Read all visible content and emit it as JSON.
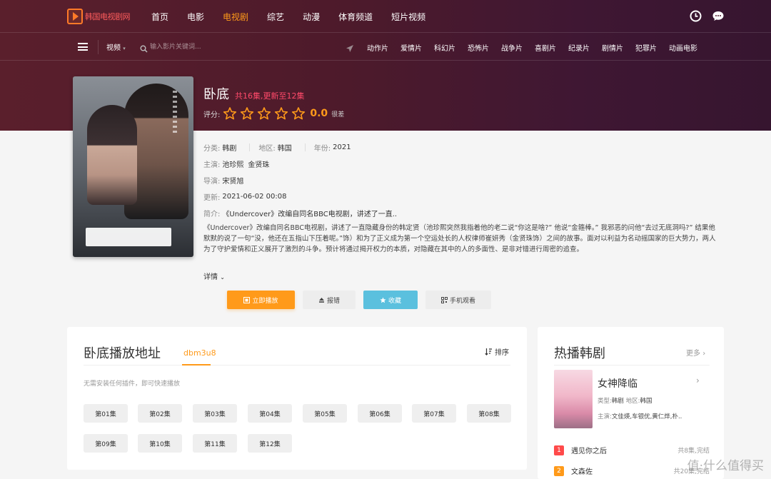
{
  "site": {
    "name": "韩国电视剧网"
  },
  "nav": {
    "items": [
      "首页",
      "电影",
      "电视剧",
      "综艺",
      "动漫",
      "体育频道",
      "短片视频"
    ],
    "active": 2
  },
  "subnav": {
    "category": "视频",
    "search_placeholder": "输入影片关键词...",
    "genres": [
      "动作片",
      "爱情片",
      "科幻片",
      "恐怖片",
      "战争片",
      "喜剧片",
      "纪录片",
      "剧情片",
      "犯罪片",
      "动画电影"
    ]
  },
  "show": {
    "title": "卧底",
    "episode_status": "共16集,更新至12集",
    "rating_label": "评分:",
    "score": "0.0",
    "score_note": "很差",
    "stars_filled": 0,
    "category_label": "分类:",
    "category": "韩剧",
    "region_label": "地区:",
    "region": "韩国",
    "year_label": "年份:",
    "year": "2021",
    "cast_label": "主演:",
    "cast": [
      "池珍熙",
      "金贤珠"
    ],
    "director_label": "导演:",
    "director": "宋贤旭",
    "updated_label": "更新:",
    "updated": "2021-06-02 00:08",
    "summary_label": "简介:",
    "summary_short": "《Undercover》改编自同名BBC电视剧，讲述了一直..",
    "summary_full": "《Undercover》改编自同名BBC电视剧，讲述了一直隐藏身份的韩定贤（池珍熙突然我指着他的老二说“你这是啥?” 他说“金箍棒。” 我邪恶的问他“去过无底洞吗?” 结果他默默的说了一句“没，他还在五指山下压着呢。”饰）和为了正义成为第一个空运处长的人权律师崔妍秀（金贤珠饰）之间的故事。面对以利益为名动摇国家的巨大势力，两人为了守护爱情和正义展开了激烈的斗争。预计将通过揭开权力的本质，对隐藏在其中的人的多面性、是非对错进行周密的追查。",
    "detail_toggle": "详情"
  },
  "actions": {
    "play": "立即播放",
    "report": "报错",
    "favorite": "收藏",
    "mobile": "手机观看"
  },
  "playlist": {
    "title": "卧底播放地址",
    "source": "dbm3u8",
    "sort_label": "排序",
    "note": "无需安装任何插件，即可快速播放",
    "episodes": [
      "第01集",
      "第02集",
      "第03集",
      "第04集",
      "第05集",
      "第06集",
      "第07集",
      "第08集",
      "第09集",
      "第10集",
      "第11集",
      "第12集"
    ]
  },
  "hot": {
    "title": "热播韩剧",
    "more": "更多",
    "featured": {
      "title": "女神降临",
      "type_label": "类型:",
      "type": "韩剧",
      "region_label": "地区:",
      "region": "韩国",
      "cast_label": "主演:",
      "cast": "文佳煐,车银优,黄仁烨,朴.."
    },
    "list": [
      {
        "rank": "1",
        "name": "遇见你之后",
        "info": "共8集,完结"
      },
      {
        "rank": "2",
        "name": "文森佐",
        "info": "共20集,完结"
      }
    ]
  },
  "watermark": "值·什么值得买",
  "colors": {
    "accent": "#ff9a1a",
    "status": "#ff4a6a",
    "fav": "#5bc0de",
    "rank1": "#ff4a4a",
    "rank2": "#ff9a1a"
  }
}
